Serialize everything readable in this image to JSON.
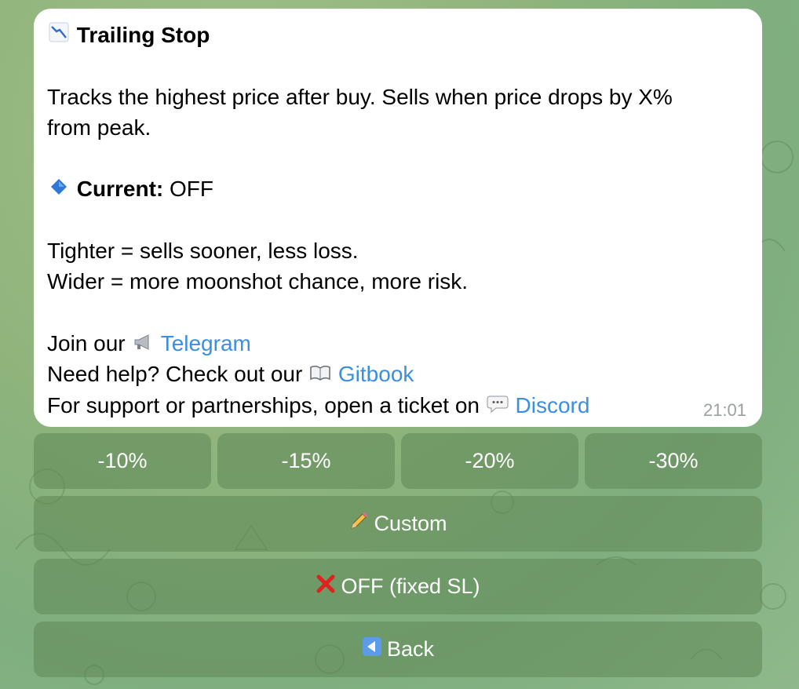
{
  "message": {
    "title_icon": "chart-decreasing-icon",
    "title": "Trailing Stop",
    "description_line1": "Tracks the highest price after buy. Sells when price drops by X%",
    "description_line2": "from peak.",
    "current_label": "Current:",
    "current_value": "OFF",
    "tighter_text": "Tighter = sells sooner, less loss.",
    "wider_text": "Wider = more moonshot chance, more risk.",
    "join_prefix": "Join our",
    "telegram_link": "Telegram",
    "help_prefix": "Need help? Check out our",
    "gitbook_link": "Gitbook",
    "support_prefix": "For support or partnerships, open a ticket on",
    "discord_link": "Discord",
    "time": "21:01"
  },
  "keyboard": {
    "row1": [
      "-10%",
      "-15%",
      "-20%",
      "-30%"
    ],
    "custom_label": "Custom",
    "off_label": "OFF (fixed SL)",
    "back_label": "Back"
  },
  "colors": {
    "link": "#3b8ee0",
    "button_bg": "rgba(95,135,85,0.55)"
  }
}
